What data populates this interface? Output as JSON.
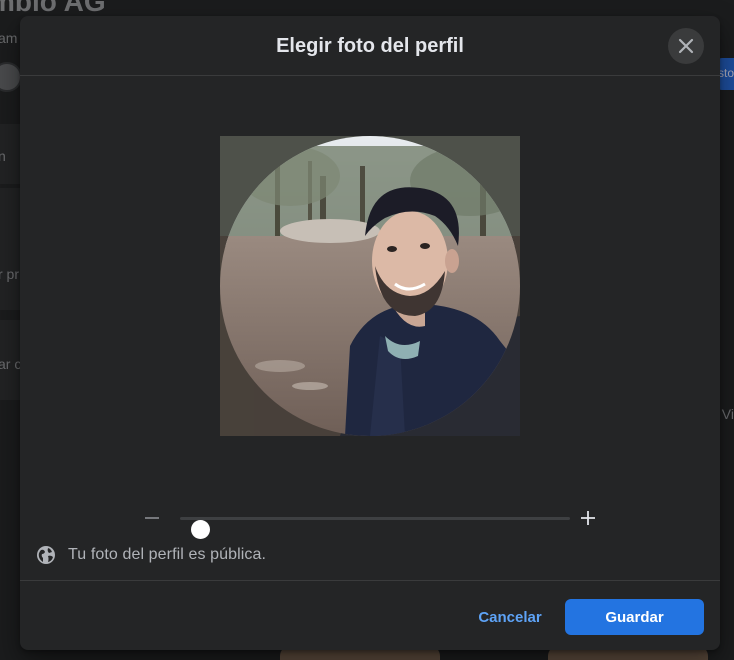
{
  "background": {
    "page_title": "mblo AG",
    "subtitle": "am",
    "left_fragments": [
      "n",
      "r pr",
      "ar c"
    ],
    "right_button": "sto",
    "right_fragment": "Š Vi"
  },
  "modal": {
    "title": "Elegir foto del perfil",
    "close_icon": "close-icon",
    "zoom": {
      "minus_icon": "minus-icon",
      "plus_icon": "plus-icon",
      "level": 0.0
    },
    "public_notice": {
      "icon": "globe-icon",
      "text": "Tu foto del perfil es pública."
    },
    "buttons": {
      "cancel_label": "Cancelar",
      "save_label": "Guardar"
    }
  },
  "colors": {
    "modal_bg": "#242526",
    "accent": "#2374e1",
    "link": "#5ea3f6",
    "text_primary": "#e4e6eb",
    "text_secondary": "#b0b3b8"
  }
}
